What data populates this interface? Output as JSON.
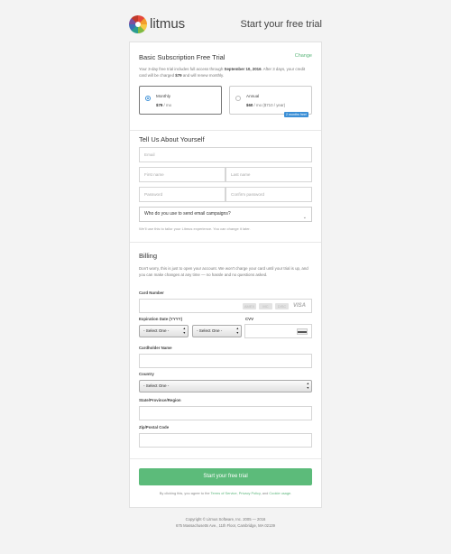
{
  "header": {
    "brand": "litmus",
    "title": "Start your free trial"
  },
  "subscription": {
    "title": "Basic Subscription Free Trial",
    "change_label": "Change",
    "desc_1": "Your 3-day free trial includes full access through ",
    "desc_date": "September 10, 2016",
    "desc_2": ". After 3 days, your credit card will be charged ",
    "desc_amount": "$79",
    "desc_3": " and will renew monthly.",
    "plans": [
      {
        "name": "Monthly",
        "price_bold": "$79",
        "price_rest": " / mo",
        "selected": true
      },
      {
        "name": "Annual",
        "price_bold": "$60",
        "price_rest": " / mo ($710 / year)",
        "selected": false,
        "badge": "2 months free!"
      }
    ]
  },
  "about": {
    "title": "Tell Us About Yourself",
    "email_placeholder": "Email",
    "first_name_placeholder": "First name",
    "last_name_placeholder": "Last name",
    "password_placeholder": "Password",
    "confirm_password_placeholder": "Confirm password",
    "campaign_select": "Who do you use to send email campaigns?",
    "hint": "We'll use this to tailor your Litmus experience. You can change it later."
  },
  "billing": {
    "title": "Billing",
    "desc": "Don't worry, this is just to open your account. We won't charge your card until your trial is up, and you can make changes at any time — no hassle and no questions asked.",
    "card_number_label": "Card Number",
    "card_brands": [
      "AMEX",
      "MC",
      "DISC",
      "VISA"
    ],
    "expiration_label": "Expiration Date (YYYY)",
    "cvv_label": "CVV",
    "month_select": "- Select One -",
    "year_select": "- Select One -",
    "cardholder_label": "Cardholder Name",
    "country_label": "Country",
    "country_select": "- Select One -",
    "state_label": "State/Province/Region",
    "zip_label": "Zip/Postal Code"
  },
  "cta": {
    "button": "Start your free trial",
    "terms_prefix": "By clicking this, you agree to the ",
    "terms_link": "Terms of Service",
    "privacy_link": "Privacy Policy",
    "cookie_link": "Cookie usage",
    "sep1": ", ",
    "sep2": ", and ",
    "end": "."
  },
  "footer": {
    "copyright": "Copyright © Litmus Software, Inc. 2005 — 2016",
    "address": "675 Massachusetts Ave., 11th Floor, Cambridge, MA 02139"
  },
  "colors": {
    "accent_green": "#5cbb7a",
    "radio_blue": "#3b8fd6"
  }
}
